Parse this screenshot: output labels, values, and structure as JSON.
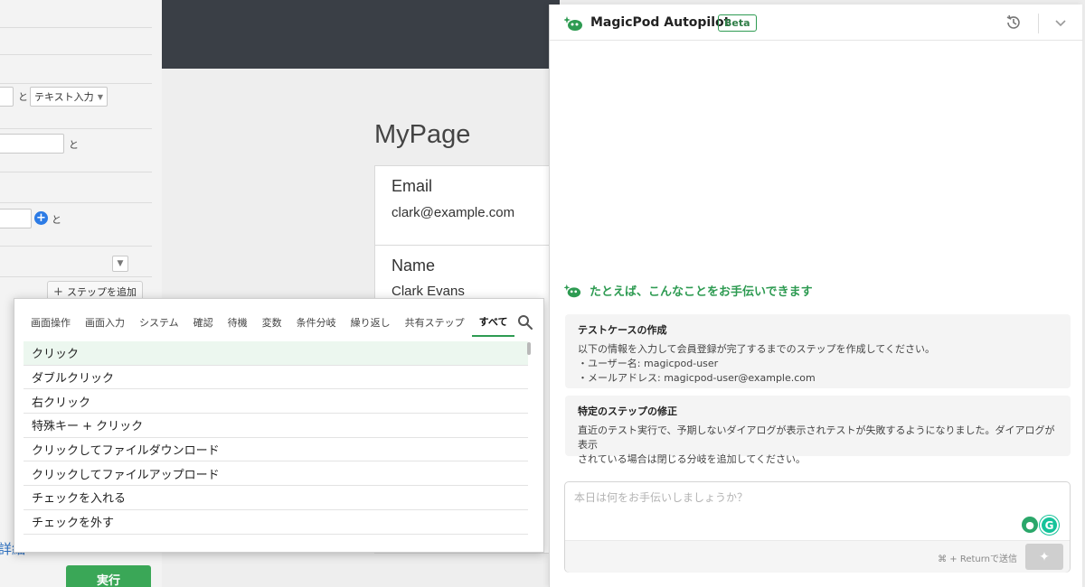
{
  "editor": {
    "and_label": "と",
    "text_input_select": "テキスト入力",
    "add_step_label": "ステップを追加",
    "detail_link": "詳細",
    "run_button": "実行"
  },
  "preview": {
    "page_title": "MyPage",
    "email_label": "Email",
    "email_value": "clark@example.com",
    "name_label": "Name",
    "name_value": "Clark Evans"
  },
  "picker": {
    "tabs": [
      {
        "label": "画面操作"
      },
      {
        "label": "画面入力"
      },
      {
        "label": "システム"
      },
      {
        "label": "確認"
      },
      {
        "label": "待機"
      },
      {
        "label": "変数"
      },
      {
        "label": "条件分岐"
      },
      {
        "label": "繰り返し"
      },
      {
        "label": "共有ステップ"
      },
      {
        "label": "すべて",
        "active": true
      }
    ],
    "items": [
      {
        "label": "クリック",
        "selected": true
      },
      {
        "label": "ダブルクリック"
      },
      {
        "label": "右クリック"
      },
      {
        "label": "特殊キー + クリック"
      },
      {
        "label": "クリックしてファイルダウンロード"
      },
      {
        "label": "クリックしてファイルアップロード"
      },
      {
        "label": "チェックを入れる"
      },
      {
        "label": "チェックを外す"
      }
    ]
  },
  "autopilot": {
    "title": "MagicPod Autopilot",
    "badge": "Beta",
    "suggest_title": "たとえば、こんなことをお手伝いできます",
    "cards": [
      {
        "title": "テストケースの作成",
        "lines": [
          "以下の情報を入力して会員登録が完了するまでのステップを作成してください。",
          "・ユーザー名: magicpod-user",
          "・メールアドレス: magicpod-user@example.com"
        ]
      },
      {
        "title": "特定のステップの修正",
        "lines": [
          "直近のテスト実行で、予期しないダイアログが表示されテストが失敗するようになりました。ダイアログが表示",
          "されている場合は閉じる分岐を追加してください。"
        ]
      }
    ],
    "input_placeholder": "本日は何をお手伝いしましょうか？",
    "shortcut_hint": "⌘ + Returnで送信",
    "accent_color": "#2e9b52"
  }
}
